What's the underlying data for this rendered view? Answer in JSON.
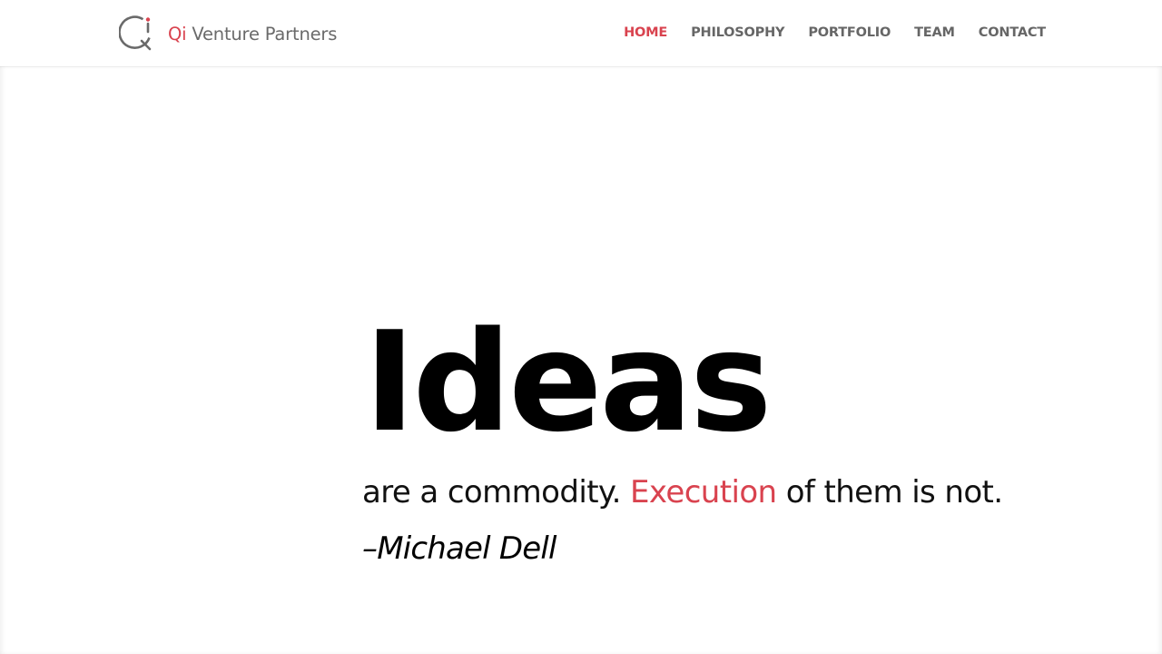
{
  "brand": {
    "name_qi": "Qi",
    "name_rest": " Venture Partners",
    "logo_icon": "q-circle-logo-icon",
    "accent_color": "#d9434f",
    "text_color": "#6a6a6a"
  },
  "nav": {
    "items": [
      {
        "label": "HOME",
        "active": true
      },
      {
        "label": "PHILOSOPHY",
        "active": false
      },
      {
        "label": "PORTFOLIO",
        "active": false
      },
      {
        "label": "TEAM",
        "active": false
      },
      {
        "label": "CONTACT",
        "active": false
      }
    ]
  },
  "hero": {
    "big_word": "Ideas",
    "line_part1": "are a commodity. ",
    "line_accent": "Execution",
    "line_part2": " of them is not.",
    "author": "–Michael Dell"
  }
}
